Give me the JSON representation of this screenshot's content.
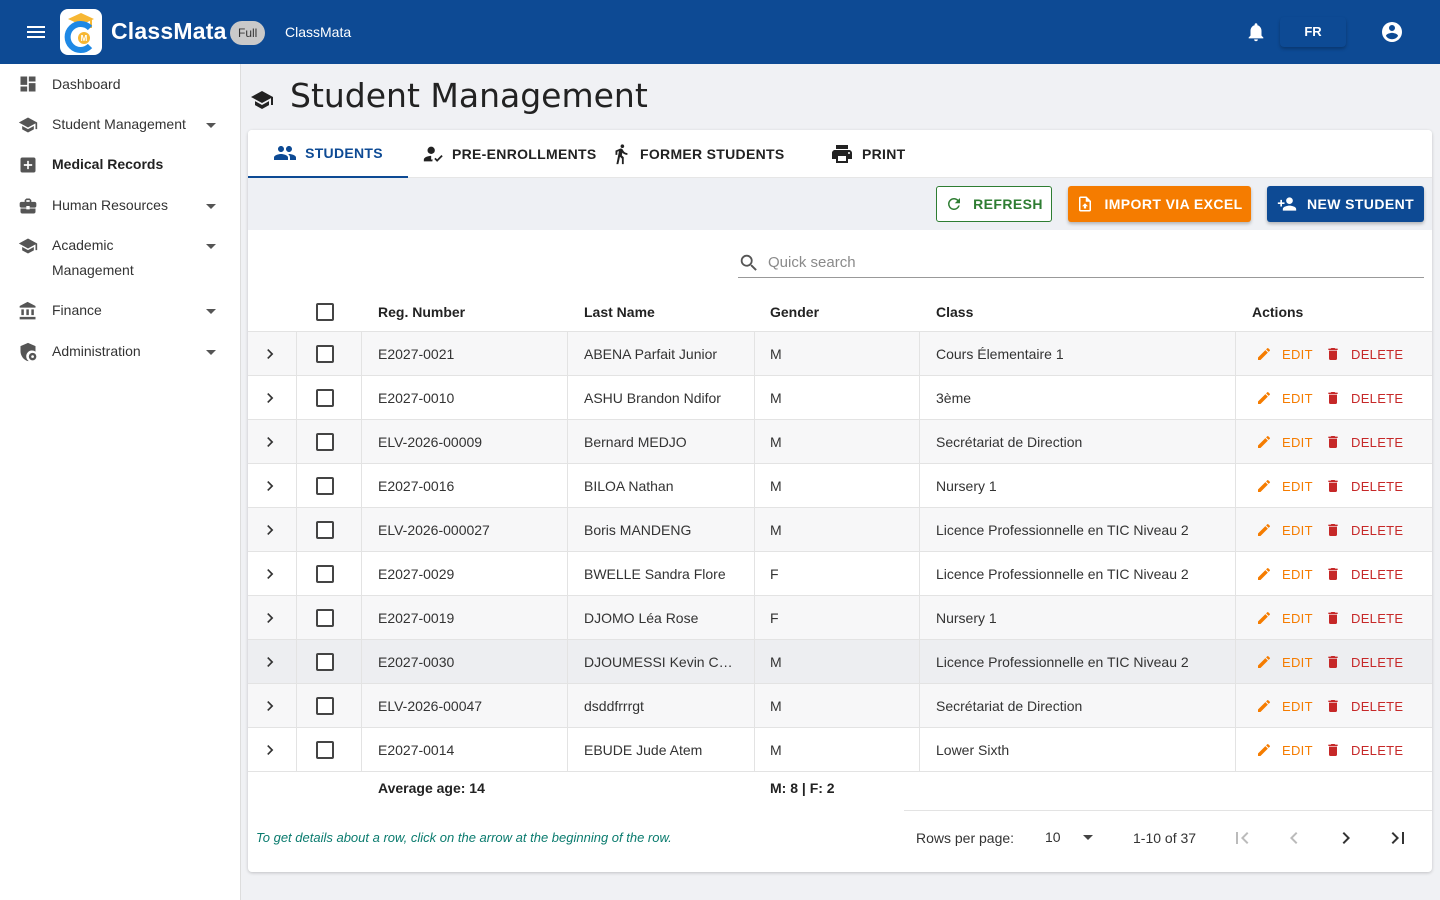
{
  "header": {
    "brand": "ClassMata",
    "badge": "Full",
    "subtitle": "ClassMata",
    "language": "FR",
    "icons": [
      "menu-icon",
      "bell-icon",
      "account-icon"
    ],
    "color": "#0d4a94"
  },
  "sidebar": {
    "items": [
      {
        "label": "Dashboard",
        "icon": "dashboard-icon",
        "expandable": false,
        "bold": false
      },
      {
        "label": "Student Management",
        "icon": "school-icon",
        "expandable": true,
        "bold": false
      },
      {
        "label": "Medical Records",
        "icon": "medical-icon",
        "expandable": false,
        "bold": true
      },
      {
        "label": "Human Resources",
        "icon": "briefcase-icon",
        "expandable": true,
        "bold": false
      },
      {
        "label": "Academic",
        "label2": "Management",
        "icon": "school-icon",
        "expandable": true,
        "bold": false
      },
      {
        "label": "Finance",
        "icon": "bank-icon",
        "expandable": true,
        "bold": false
      },
      {
        "label": "Administration",
        "icon": "admin-shield-icon",
        "expandable": true,
        "bold": false
      }
    ]
  },
  "page": {
    "title": "Student Management"
  },
  "tabs": [
    {
      "label": "STUDENTS",
      "icon": "people-icon",
      "active": true
    },
    {
      "label": "PRE-ENROLLMENTS",
      "icon": "person-check-icon",
      "active": false
    },
    {
      "label": "FORMER STUDENTS",
      "icon": "walking-person-icon",
      "active": false
    },
    {
      "label": "PRINT",
      "icon": "printer-icon",
      "active": false
    }
  ],
  "toolbar": {
    "refresh": "REFRESH",
    "import": "IMPORT VIA EXCEL",
    "new_student": "NEW STUDENT",
    "colors": {
      "refresh": "#2e7d32",
      "import": "#f57c00",
      "new": "#0d4a94"
    }
  },
  "search": {
    "placeholder": "Quick search"
  },
  "table": {
    "columns": [
      "Reg. Number",
      "Last Name",
      "Gender",
      "Class",
      "Actions"
    ],
    "edit_label": "EDIT",
    "delete_label": "DELETE",
    "rows": [
      {
        "reg": "E2027-0021",
        "name": "ABENA Parfait Junior",
        "gender": "M",
        "class": "Cours Élementaire 1"
      },
      {
        "reg": "E2027-0010",
        "name": "ASHU Brandon Ndifor",
        "gender": "M",
        "class": "3ème"
      },
      {
        "reg": "ELV-2026-00009",
        "name": "Bernard MEDJO",
        "gender": "M",
        "class": "Secrétariat de Direction"
      },
      {
        "reg": "E2027-0016",
        "name": "BILOA Nathan",
        "gender": "M",
        "class": "Nursery 1"
      },
      {
        "reg": "ELV-2026-000027",
        "name": "Boris MANDENG",
        "gender": "M",
        "class": "Licence Professionnelle en TIC Niveau 2"
      },
      {
        "reg": "E2027-0029",
        "name": "BWELLE Sandra Flore",
        "gender": "F",
        "class": "Licence Professionnelle en TIC Niveau 2"
      },
      {
        "reg": "E2027-0019",
        "name": "DJOMO Léa Rose",
        "gender": "F",
        "class": "Nursery 1"
      },
      {
        "reg": "E2027-0030",
        "name": "DJOUMESSI Kevin Ca...",
        "gender": "M",
        "class": "Licence Professionnelle en TIC Niveau 2"
      },
      {
        "reg": "ELV-2026-00047",
        "name": "dsddfrrrgt",
        "gender": "M",
        "class": "Secrétariat de Direction"
      },
      {
        "reg": "E2027-0014",
        "name": "EBUDE Jude Atem",
        "gender": "M",
        "class": "Lower Sixth"
      }
    ],
    "summary_age": "Average age: 14",
    "summary_gender": "M: 8 | F: 2"
  },
  "footer": {
    "note": "To get details about a row, click on the arrow at the beginning of the row.",
    "rows_per_page_label": "Rows per page:",
    "rows_per_page": "10",
    "range": "1-10 of 37"
  }
}
